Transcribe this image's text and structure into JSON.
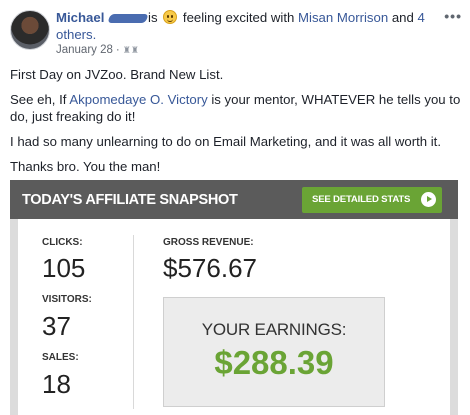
{
  "post": {
    "author": "Michael",
    "status_prefix": "is",
    "status_text": "feeling excited with",
    "tagged_friend": "Misan Morrison",
    "and_text": "and",
    "others_link": "4 others.",
    "date": "January 28",
    "separator": "·",
    "privacy_icon": "friends-icon",
    "more_label": "•••"
  },
  "body": {
    "line1": "First Day on JVZoo. Brand New List.",
    "line2_before": "See eh, If ",
    "line2_mention": "Akpomedaye O. Victory",
    "line2_after": " is your mentor, WHATEVER he tells you to do, just freaking do it!",
    "line3": "I had so many unlearning to do on Email Marketing, and it was all worth it.",
    "line4": "Thanks bro. You the man!"
  },
  "snapshot": {
    "title": "TODAY'S AFFILIATE SNAPSHOT",
    "button_label": "SEE DETAILED STATS",
    "clicks_label": "CLICKS:",
    "clicks_value": "105",
    "visitors_label": "VISITORS:",
    "visitors_value": "37",
    "sales_label": "SALES:",
    "sales_value": "18",
    "revenue_label": "GROSS REVENUE:",
    "revenue_value": "$576.67",
    "earnings_label": "YOUR EARNINGS:",
    "earnings_value": "$288.39",
    "accent_color": "#6aa435"
  }
}
